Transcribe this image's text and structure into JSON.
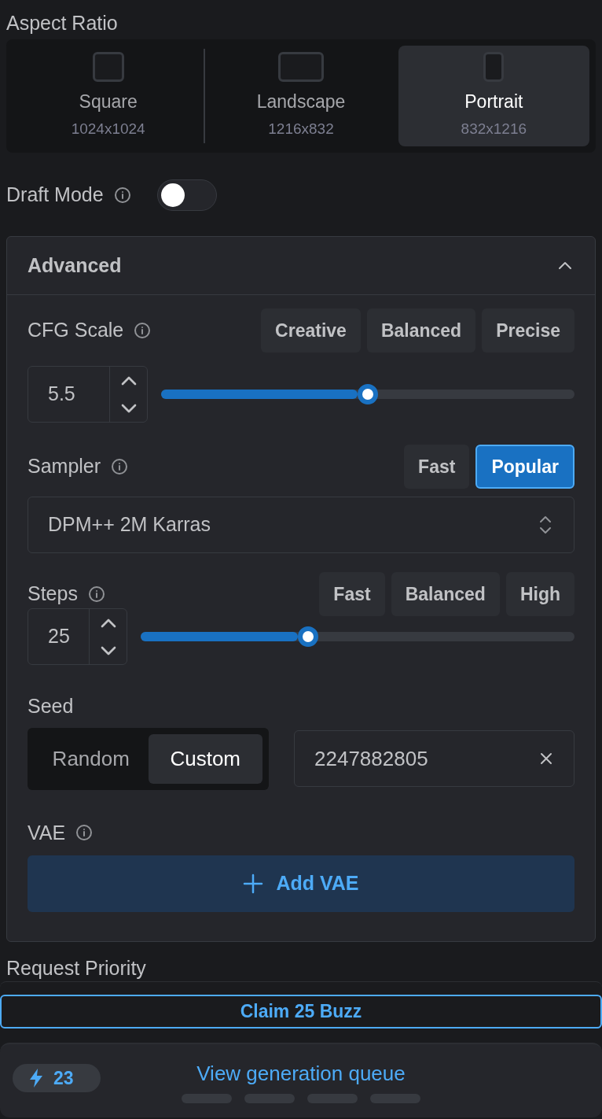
{
  "aspect_ratio": {
    "label": "Aspect Ratio",
    "options": [
      {
        "kind": "square",
        "label": "Square",
        "size": "1024x1024",
        "selected": false
      },
      {
        "kind": "landscape",
        "label": "Landscape",
        "size": "1216x832",
        "selected": false
      },
      {
        "kind": "portrait",
        "label": "Portrait",
        "size": "832x1216",
        "selected": true
      }
    ]
  },
  "draft_mode": {
    "label": "Draft Mode",
    "on": false
  },
  "advanced": {
    "title": "Advanced",
    "expanded": true,
    "cfg_scale": {
      "label": "CFG Scale",
      "presets": [
        {
          "label": "Creative",
          "selected": false
        },
        {
          "label": "Balanced",
          "selected": false
        },
        {
          "label": "Precise",
          "selected": false
        }
      ],
      "value": "5.5",
      "level": 0.5
    },
    "sampler": {
      "label": "Sampler",
      "presets": [
        {
          "label": "Fast",
          "selected": false
        },
        {
          "label": "Popular",
          "selected": true
        }
      ],
      "value": "DPM++ 2M Karras"
    },
    "steps": {
      "label": "Steps",
      "presets": [
        {
          "label": "Fast",
          "selected": false
        },
        {
          "label": "Balanced",
          "selected": false
        },
        {
          "label": "High",
          "selected": false
        }
      ],
      "value": "25",
      "level": 0.38
    },
    "seed": {
      "label": "Seed",
      "modes": [
        {
          "label": "Random",
          "selected": false
        },
        {
          "label": "Custom",
          "selected": true
        }
      ],
      "value": "2247882805"
    },
    "vae": {
      "label": "VAE",
      "button": "Add VAE"
    }
  },
  "request_priority": {
    "label": "Request Priority"
  },
  "claim_button": "Claim 25 Buzz",
  "queue": {
    "buzz": "23",
    "link": "View generation queue"
  }
}
